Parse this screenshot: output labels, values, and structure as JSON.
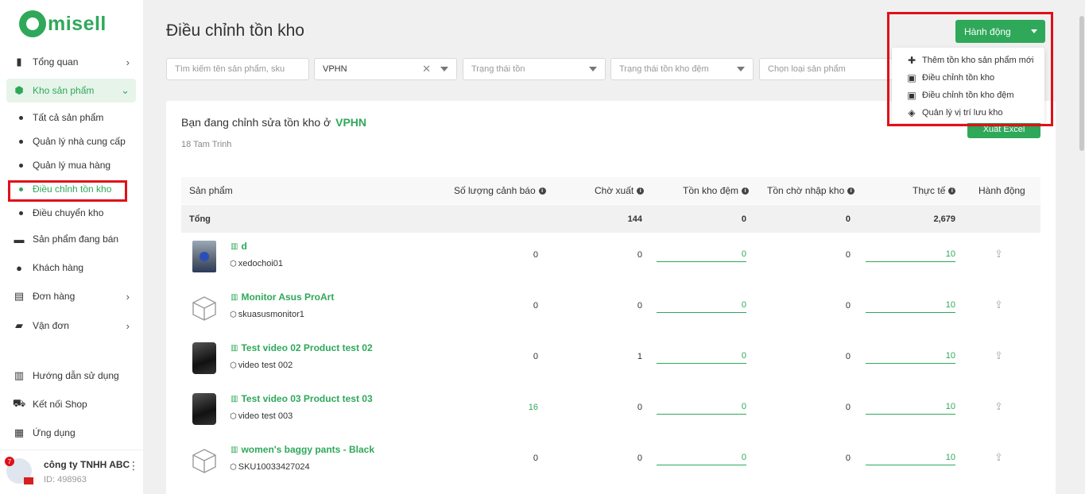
{
  "brand": {
    "logo_text": "misell",
    "accent": "#2fa85a",
    "highlight": "#e0101a"
  },
  "sidebar": {
    "items": [
      {
        "label": "Tổng quan",
        "icon": "bar-chart-icon",
        "chevron": "›"
      },
      {
        "label": "Kho sản phẩm",
        "icon": "box-icon",
        "chevron": "⌄"
      },
      {
        "label": "Sản phẩm đang bán",
        "icon": "briefcase-icon"
      },
      {
        "label": "Khách hàng",
        "icon": "users-icon"
      },
      {
        "label": "Đơn hàng",
        "icon": "orders-icon",
        "chevron": "›"
      },
      {
        "label": "Vận đơn",
        "icon": "truck-icon",
        "chevron": "›"
      },
      {
        "label": "Hướng dẫn sử dụng",
        "icon": "map-icon"
      },
      {
        "label": "Kết nối Shop",
        "icon": "cart-icon"
      },
      {
        "label": "Ứng dụng",
        "icon": "apps-icon"
      }
    ],
    "subitems": [
      {
        "label": "Tất cả sản phẩm"
      },
      {
        "label": "Quản lý nhà cung cấp"
      },
      {
        "label": "Quản lý mua hàng"
      },
      {
        "label": "Điều chỉnh tồn kho"
      },
      {
        "label": "Điều chuyển kho"
      }
    ],
    "company": {
      "name": "công ty TNHH ABC",
      "id": "ID: 498963",
      "badge": "7"
    }
  },
  "header": {
    "title": "Điều chỉnh tồn kho",
    "action_label": "Hành động",
    "menu": [
      {
        "label": "Thêm tồn kho sản phẩm mới",
        "icon": "plus-icon"
      },
      {
        "label": "Điều chỉnh tồn kho",
        "icon": "excel-file-icon"
      },
      {
        "label": "Điều chỉnh tồn kho đệm",
        "icon": "excel-file-icon"
      },
      {
        "label": "Quản lý vị trí lưu kho",
        "icon": "boxes-icon"
      }
    ]
  },
  "filters": {
    "search_placeholder": "Tìm kiếm tên sản phẩm, sku",
    "warehouse_value": "VPHN",
    "stock_status_placeholder": "Trạng thái tồn",
    "buffer_status_placeholder": "Trạng thái tồn kho đệm",
    "product_type_placeholder": "Chọn loại sản phẩm"
  },
  "card": {
    "heading_prefix": "Bạn đang chỉnh sửa tồn kho ở",
    "location": "VPHN",
    "address": "18 Tam Trinh",
    "export_label": "Xuất Excel"
  },
  "table": {
    "headers": {
      "product": "Sản phẩm",
      "warning_qty": "Số lượng cảnh báo",
      "pending_out": "Chờ xuất",
      "buffer_stock": "Tồn kho đệm",
      "pending_in": "Tồn chờ nhập kho",
      "actual": "Thực tế",
      "actions": "Hành động"
    },
    "total": {
      "label": "Tổng",
      "pending_out": "144",
      "buffer_stock": "0",
      "pending_in": "0",
      "actual": "2,679"
    },
    "rows": [
      {
        "name": "d",
        "sku": "xedochoi01",
        "warning": "0",
        "pending_out": "0",
        "buffer": "0",
        "pending_in": "0",
        "actual": "10",
        "thumb": "photo"
      },
      {
        "name": "Monitor Asus ProArt",
        "sku": "skuasusmonitor1",
        "warning": "0",
        "pending_out": "0",
        "buffer": "0",
        "pending_in": "0",
        "actual": "10",
        "thumb": "box"
      },
      {
        "name": "Test video 02 Product test 02",
        "sku": "video test 002",
        "warning": "0",
        "pending_out": "1",
        "buffer": "0",
        "pending_in": "0",
        "actual": "10",
        "thumb": "dark"
      },
      {
        "name": "Test video 03 Product test 03",
        "sku": "video test 003",
        "warning": "16",
        "pending_out": "0",
        "buffer": "0",
        "pending_in": "0",
        "actual": "10",
        "thumb": "dark"
      },
      {
        "name": "women's baggy pants - Black",
        "sku": "SKU10033427024",
        "warning": "0",
        "pending_out": "0",
        "buffer": "0",
        "pending_in": "0",
        "actual": "10",
        "thumb": "box"
      }
    ]
  }
}
